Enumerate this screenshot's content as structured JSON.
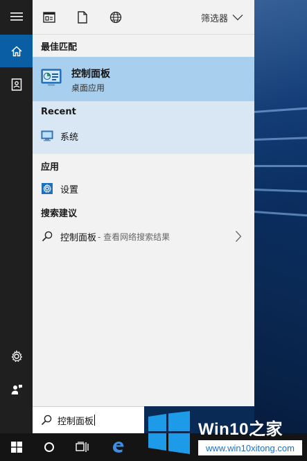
{
  "toolbar": {
    "icons": [
      "apps-icon",
      "document-icon",
      "globe-icon"
    ],
    "filter_label": "筛选器"
  },
  "rail": {
    "items": [
      "hamburger-icon",
      "home-icon",
      "notebook-icon",
      "settings-icon",
      "feedback-icon"
    ],
    "active": "home-icon"
  },
  "sections": {
    "best_match": "最佳匹配",
    "recent": "Recent",
    "apps": "应用",
    "suggestions": "搜索建议"
  },
  "best_match": {
    "title": "控制面板",
    "subtitle": "桌面应用"
  },
  "recent_items": [
    {
      "label": "系统",
      "icon": "monitor-icon"
    }
  ],
  "app_items": [
    {
      "label": "设置",
      "icon": "gear-icon"
    }
  ],
  "suggestion": {
    "query": "控制面板",
    "suffix": "- 查看网络搜索结果"
  },
  "search_box": {
    "value": "控制面板"
  },
  "taskbar": {
    "items": [
      "windows-start-icon",
      "cortana-icon",
      "task-view-icon",
      "edge-icon"
    ]
  },
  "watermark": {
    "brand": "Win10",
    "brand_zh": "之家",
    "url": "www.win10xitong.com"
  },
  "colors": {
    "accent": "#0a5fa4",
    "best_match_bg": "#a9cfee",
    "recent_bg": "#d9e7f4",
    "panel_bg": "#f2f2f2",
    "rail_bg": "#1f1f1f",
    "taskbar_bg": "#141414"
  }
}
